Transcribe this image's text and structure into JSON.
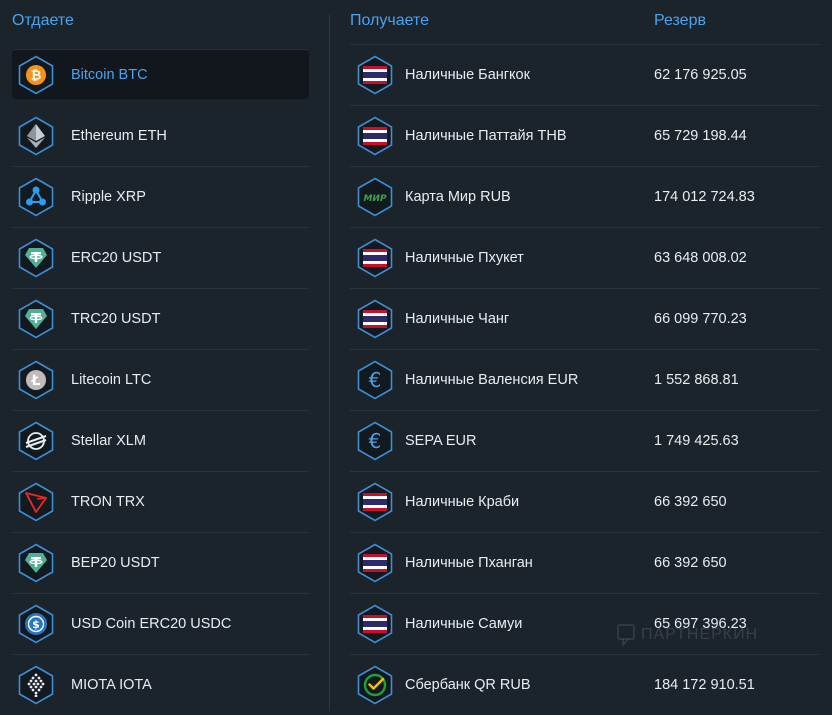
{
  "give": {
    "header": "Отдаете",
    "items": [
      {
        "label": "Bitcoin BTC",
        "icon": "bitcoin-icon",
        "active": true
      },
      {
        "label": "Ethereum ETH",
        "icon": "ethereum-icon"
      },
      {
        "label": "Ripple XRP",
        "icon": "ripple-icon"
      },
      {
        "label": "ERC20 USDT",
        "icon": "tether-icon"
      },
      {
        "label": "TRC20 USDT",
        "icon": "tether-icon"
      },
      {
        "label": "Litecoin LTC",
        "icon": "litecoin-icon"
      },
      {
        "label": "Stellar XLM",
        "icon": "stellar-icon"
      },
      {
        "label": "TRON TRX",
        "icon": "tron-icon"
      },
      {
        "label": "BEP20 USDT",
        "icon": "tether-icon"
      },
      {
        "label": "USD Coin ERC20 USDC",
        "icon": "usdc-icon"
      },
      {
        "label": "MIOTA IOTA",
        "icon": "iota-icon"
      }
    ]
  },
  "get": {
    "header": "Получаете",
    "reserve_header": "Резерв",
    "items": [
      {
        "label": "Наличные Бангкок",
        "reserve": "62 176 925.05",
        "icon": "thai-flag-icon"
      },
      {
        "label": "Наличные Паттайя THB",
        "reserve": "65 729 198.44",
        "icon": "thai-flag-icon"
      },
      {
        "label": "Карта Мир RUB",
        "reserve": "174 012 724.83",
        "icon": "mir-card-icon",
        "icon_text": "МИР"
      },
      {
        "label": "Наличные Пхукет",
        "reserve": "63 648 008.02",
        "icon": "thai-flag-icon"
      },
      {
        "label": "Наличные Чанг",
        "reserve": "66 099 770.23",
        "icon": "thai-flag-icon"
      },
      {
        "label": "Наличные Валенсия EUR",
        "reserve": "1 552 868.81",
        "icon": "euro-icon"
      },
      {
        "label": "SEPA EUR",
        "reserve": "1 749 425.63",
        "icon": "euro-icon"
      },
      {
        "label": "Наличные Краби",
        "reserve": "66 392 650",
        "icon": "thai-flag-icon"
      },
      {
        "label": "Наличные Пханган",
        "reserve": "66 392 650",
        "icon": "thai-flag-icon"
      },
      {
        "label": "Наличные Самуи",
        "reserve": "65 697 396.23",
        "icon": "thai-flag-icon"
      },
      {
        "label": "Сбербанк QR RUB",
        "reserve": "184 172 910.51",
        "icon": "sberbank-icon"
      }
    ]
  },
  "watermark": {
    "text": "ПАРТНЕРКИН"
  },
  "colors": {
    "background": "#1b232b",
    "accent": "#4aa3f0",
    "hex_border": "#3d8fd6",
    "active_row": "#11171d"
  }
}
